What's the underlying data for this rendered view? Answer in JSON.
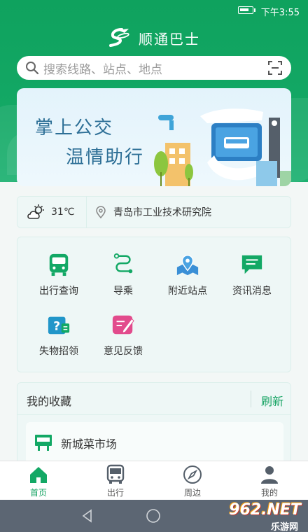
{
  "status_bar": {
    "time": "下午3:55",
    "battery_level": 0.8
  },
  "app": {
    "title": "顺通巴士",
    "logo_icon": "shuntong-logo-icon"
  },
  "search": {
    "placeholder": "搜索线路、站点、地点"
  },
  "banner": {
    "line1": "掌上公交",
    "line2": "温情助行"
  },
  "weather": {
    "temperature": "31℃",
    "location": "青岛市工业技术研究院"
  },
  "services": [
    {
      "label": "出行查询",
      "icon": "bus-icon",
      "color": "#13a865"
    },
    {
      "label": "导乘",
      "icon": "route-icon",
      "color": "#13a865"
    },
    {
      "label": "附近站点",
      "icon": "map-pin-icon",
      "color": "#3a8fd6"
    },
    {
      "label": "资讯消息",
      "icon": "message-icon",
      "color": "#13a865"
    },
    {
      "label": "失物招领",
      "icon": "lost-found-icon",
      "color": "#2196c9"
    },
    {
      "label": "意见反馈",
      "icon": "feedback-icon",
      "color": "#e24b8c"
    }
  ],
  "favorites": {
    "title": "我的收藏",
    "refresh": "刷新",
    "items": [
      {
        "name": "新城菜市场"
      }
    ]
  },
  "tabs": [
    {
      "label": "首页",
      "icon": "home-icon",
      "active": true
    },
    {
      "label": "出行",
      "icon": "bus-icon",
      "active": false
    },
    {
      "label": "周边",
      "icon": "compass-icon",
      "active": false
    },
    {
      "label": "我的",
      "icon": "user-icon",
      "active": false
    }
  ],
  "watermark": {
    "brand": "962.NET",
    "sub": "乐游网"
  },
  "colors": {
    "primary": "#13a865",
    "accent_text": "#16a363"
  }
}
